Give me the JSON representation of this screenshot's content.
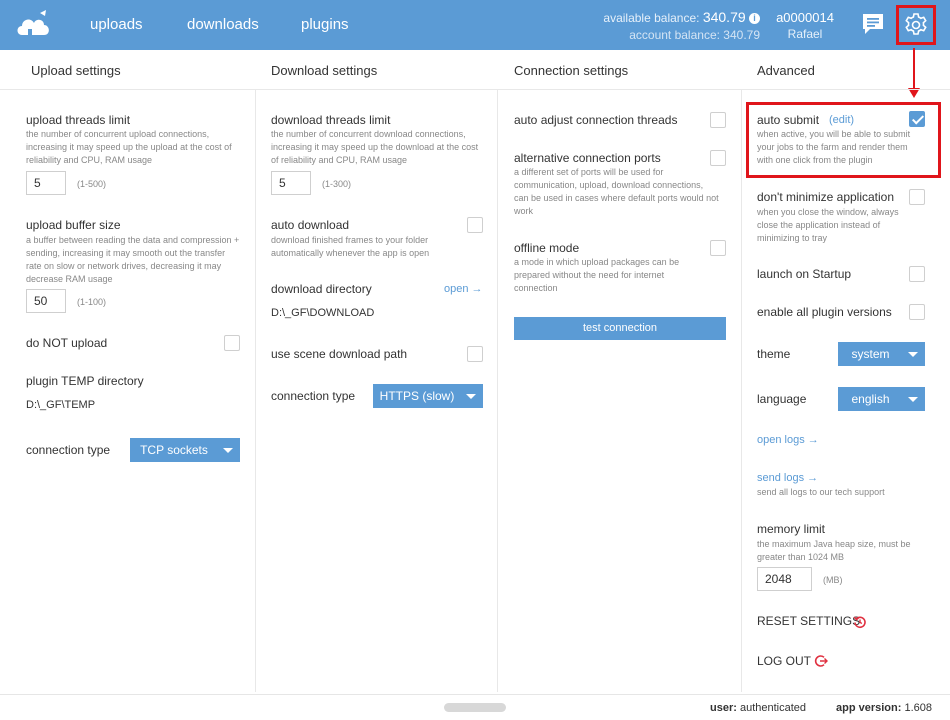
{
  "nav": {
    "uploads": "uploads",
    "downloads": "downloads",
    "plugins": "plugins"
  },
  "balance": {
    "available_label": "available balance:",
    "available_value": "340.79",
    "account_label": "account balance:",
    "account_value": "340.79"
  },
  "user": {
    "id": "a0000014",
    "name": "Rafael"
  },
  "columns": {
    "upload": "Upload settings",
    "download": "Download settings",
    "connection": "Connection settings",
    "advanced": "Advanced"
  },
  "upload": {
    "threads_label": "upload threads limit",
    "threads_desc": "the number of concurrent upload connections, increasing it may speed up the upload at the cost of reliability and CPU, RAM usage",
    "threads_value": "5",
    "threads_range": "(1-500)",
    "buffer_label": "upload buffer size",
    "buffer_desc": "a buffer between reading the data and compression + sending, increasing it may smooth out the transfer rate on slow or network drives, decreasing it may decrease RAM usage",
    "buffer_value": "50",
    "buffer_range": "(1-100)",
    "do_not_upload": "do NOT upload",
    "temp_label": "plugin TEMP directory",
    "temp_path": "D:\\_GF\\TEMP",
    "conn_type_label": "connection type",
    "conn_type_value": "TCP sockets"
  },
  "download": {
    "threads_label": "download threads limit",
    "threads_desc": "the number of concurrent download connections, increasing it may speed up the download at the cost of reliability and CPU, RAM usage",
    "threads_value": "5",
    "threads_range": "(1-300)",
    "auto_label": "auto download",
    "auto_desc": "download finished frames to your folder automatically whenever the app is open",
    "dir_label": "download directory",
    "open_link": "open →",
    "dir_path": "D:\\_GF\\DOWNLOAD",
    "scene_path_label": "use scene download path",
    "conn_type_label": "connection type",
    "conn_type_value": "HTTPS (slow)"
  },
  "connection": {
    "auto_adjust": "auto adjust connection threads",
    "alt_ports_label": "alternative connection ports",
    "alt_ports_desc": "a different set of ports will be used for communication, upload, download connections, can be used in cases where default ports would not work",
    "offline_label": "offline mode",
    "offline_desc": "a mode in which upload packages can be prepared without the need for internet connection",
    "test_button": "test connection"
  },
  "advanced": {
    "auto_submit_label": "auto submit",
    "auto_submit_edit": "(edit)",
    "auto_submit_desc": "when active, you will be able to submit your jobs to the farm and render them with one click from the plugin",
    "auto_submit_checked": true,
    "minimize_label": "don't minimize application",
    "minimize_desc": "when you close the window, always close the application instead of minimizing to tray",
    "startup_label": "launch on Startup",
    "plugin_versions_label": "enable all plugin versions",
    "theme_label": "theme",
    "theme_value": "system",
    "language_label": "language",
    "language_value": "english",
    "open_logs": "open logs →",
    "send_logs": "send logs →",
    "send_logs_desc": "send all logs to our tech support",
    "memory_label": "memory limit",
    "memory_desc": "the maximum Java heap size, must be greater than 1024 MB",
    "memory_value": "2048",
    "memory_unit": "(MB)",
    "reset": "RESET SETTINGS",
    "logout": "LOG OUT"
  },
  "footer": {
    "user_label": "user:",
    "user_value": "authenticated",
    "version_label": "app version:",
    "version_value": "1.608"
  },
  "colors": {
    "accent": "#5b9bd5",
    "highlight": "#e0151b",
    "danger": "#e03040"
  }
}
